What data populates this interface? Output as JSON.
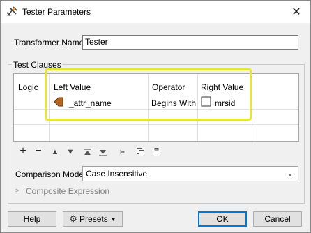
{
  "window": {
    "title": "Tester Parameters"
  },
  "transformer": {
    "label": "Transformer Name:",
    "value": "Tester"
  },
  "test_clauses": {
    "group_label": "Test Clauses",
    "columns": [
      "Logic",
      "Left Value",
      "Operator",
      "Right Value"
    ],
    "rows": [
      {
        "logic": "",
        "left_value": "_attr_name",
        "operator": "Begins With",
        "right_value": "mrsid"
      }
    ]
  },
  "toolbar": {
    "icons": [
      "add-icon",
      "remove-icon",
      "move-up-icon",
      "move-down-icon",
      "move-top-icon",
      "move-bottom-icon",
      "cut-icon",
      "copy-icon",
      "paste-icon"
    ]
  },
  "comparison_mode": {
    "label": "Comparison Mode:",
    "value": "Case Insensitive"
  },
  "composite_expression": {
    "label": "Composite Expression"
  },
  "buttons": {
    "help": "Help",
    "presets": "Presets",
    "ok": "OK",
    "cancel": "Cancel"
  },
  "colors": {
    "highlight": "#e7e53a",
    "accent": "#0078d7",
    "attribute_icon": "#b5651d"
  }
}
